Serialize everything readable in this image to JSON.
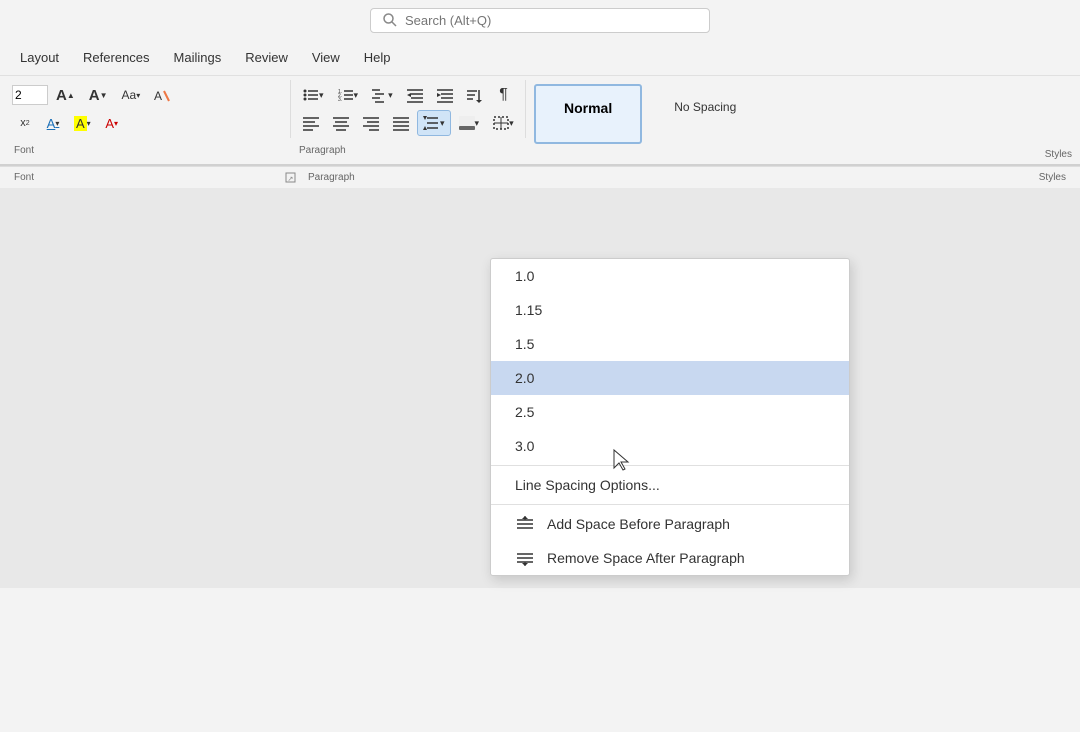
{
  "titlebar": {
    "search_placeholder": "Search (Alt+Q)"
  },
  "menubar": {
    "items": [
      {
        "label": "Layout",
        "id": "layout"
      },
      {
        "label": "References",
        "id": "references"
      },
      {
        "label": "Mailings",
        "id": "mailings"
      },
      {
        "label": "Review",
        "id": "review"
      },
      {
        "label": "View",
        "id": "view"
      },
      {
        "label": "Help",
        "id": "help"
      }
    ]
  },
  "ribbon": {
    "font_size": "2",
    "section_labels": {
      "font": "Font",
      "paragraph": "Paragraph",
      "styles": "Styles"
    }
  },
  "styles": {
    "normal": "Normal",
    "no_spacing": "No Spacing"
  },
  "dropdown": {
    "spacing_options": [
      {
        "value": "1.0",
        "id": "spacing-1"
      },
      {
        "value": "1.15",
        "id": "spacing-115"
      },
      {
        "value": "1.5",
        "id": "spacing-15"
      },
      {
        "value": "2.0",
        "id": "spacing-20",
        "highlighted": true
      },
      {
        "value": "2.5",
        "id": "spacing-25"
      },
      {
        "value": "3.0",
        "id": "spacing-30"
      }
    ],
    "line_spacing_options": "Line Spacing Options...",
    "add_space_before": "Add Space Before Paragraph",
    "remove_space_after": "Remove Space After Paragraph"
  }
}
